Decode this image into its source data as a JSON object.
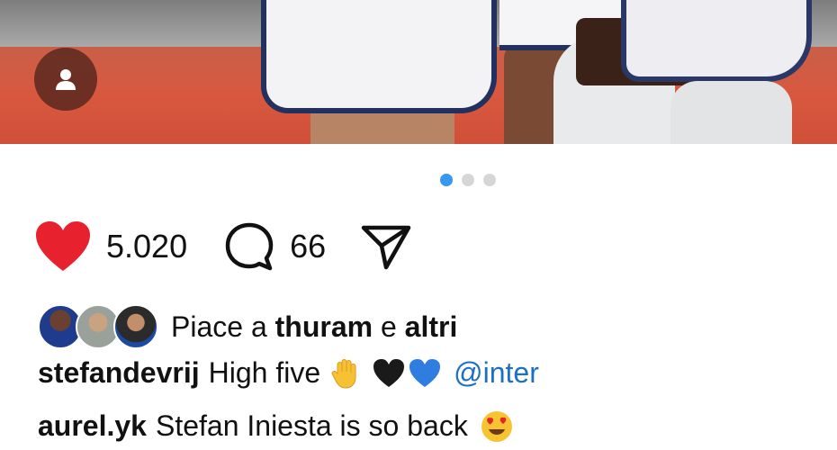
{
  "post": {
    "like_count": "5.020",
    "comment_count": "66",
    "carousel_dots": 3,
    "carousel_active_index": 0
  },
  "likes": {
    "prefix": "Piace a",
    "user": "thuram",
    "conjunction": "e",
    "others": "altri"
  },
  "caption": {
    "username": "stefandevrij",
    "text": "High five",
    "mention": "@inter"
  },
  "comment": {
    "username": "aurel.yk",
    "text": "Stefan Iniesta is so back"
  },
  "colors": {
    "heart": "#e8212e",
    "active_dot": "#3897f0",
    "mention": "#1d6fc4"
  }
}
